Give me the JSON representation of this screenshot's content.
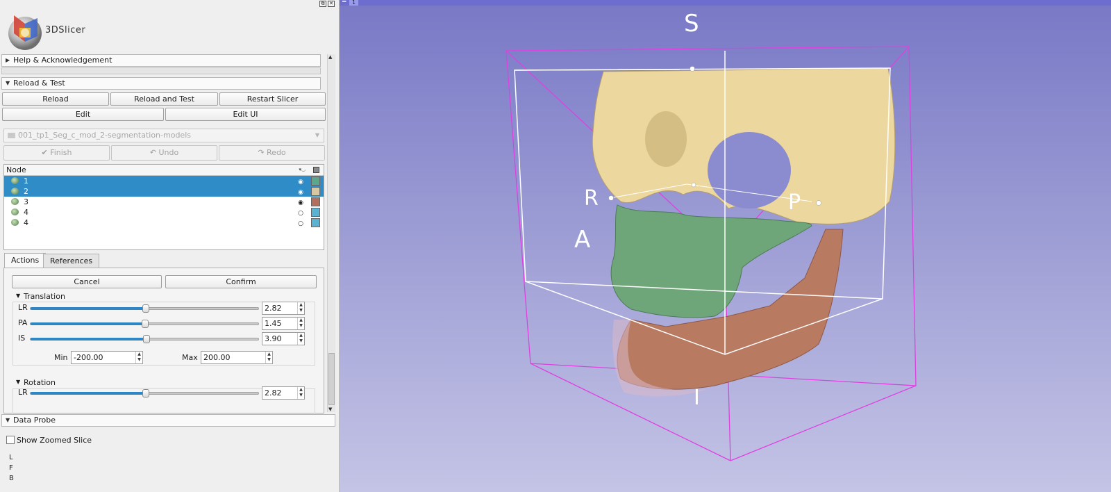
{
  "app": {
    "name": "3DSlicer"
  },
  "window_buttons": [
    "⧉",
    "✕"
  ],
  "sections": {
    "help": "Help & Acknowledgement",
    "reload_test": "Reload & Test",
    "data_probe": "Data Probe"
  },
  "reload_buttons": {
    "reload": "Reload",
    "reload_and_test": "Reload and Test",
    "restart": "Restart Slicer",
    "edit": "Edit",
    "edit_ui": "Edit UI"
  },
  "segmentation_combo": "001_tp1_Seg_c_mod_2-segmentation-models",
  "edit_buttons": {
    "finish": "Finish",
    "undo": "Undo",
    "redo": "Redo"
  },
  "tree": {
    "header": "Node",
    "rows": [
      {
        "name": "1",
        "selected": true,
        "visible": true,
        "color": "#5aa78e"
      },
      {
        "name": "2",
        "selected": true,
        "visible": true,
        "color": "#d6c8a2"
      },
      {
        "name": "3",
        "selected": false,
        "visible": true,
        "color": "#b36f5d"
      },
      {
        "name": "4",
        "selected": false,
        "visible": false,
        "color": "#5bb3d1"
      },
      {
        "name": "4",
        "selected": false,
        "visible": false,
        "color": "#5bb3d1"
      }
    ]
  },
  "tabs": {
    "actions": "Actions",
    "references": "References"
  },
  "transform": {
    "cancel": "Cancel",
    "confirm": "Confirm",
    "translation_title": "Translation",
    "translation": [
      {
        "label": "LR",
        "value": "2.82",
        "fraction": 0.505
      },
      {
        "label": "PA",
        "value": "1.45",
        "fraction": 0.502
      },
      {
        "label": "IS",
        "value": "3.90",
        "fraction": 0.508
      }
    ],
    "min_label": "Min",
    "min_value": "-200.00",
    "max_label": "Max",
    "max_value": "200.00",
    "rotation_title": "Rotation",
    "rotation": [
      {
        "label": "LR",
        "value": "2.82",
        "fraction": 0.505
      }
    ]
  },
  "data_probe": {
    "show_zoomed_slice": "Show Zoomed Slice",
    "lines": [
      "L",
      "F",
      "B"
    ]
  },
  "view": {
    "number": "1",
    "orientation": {
      "S": "S",
      "R": "R",
      "P": "P",
      "A": "A",
      "I": "I"
    }
  }
}
